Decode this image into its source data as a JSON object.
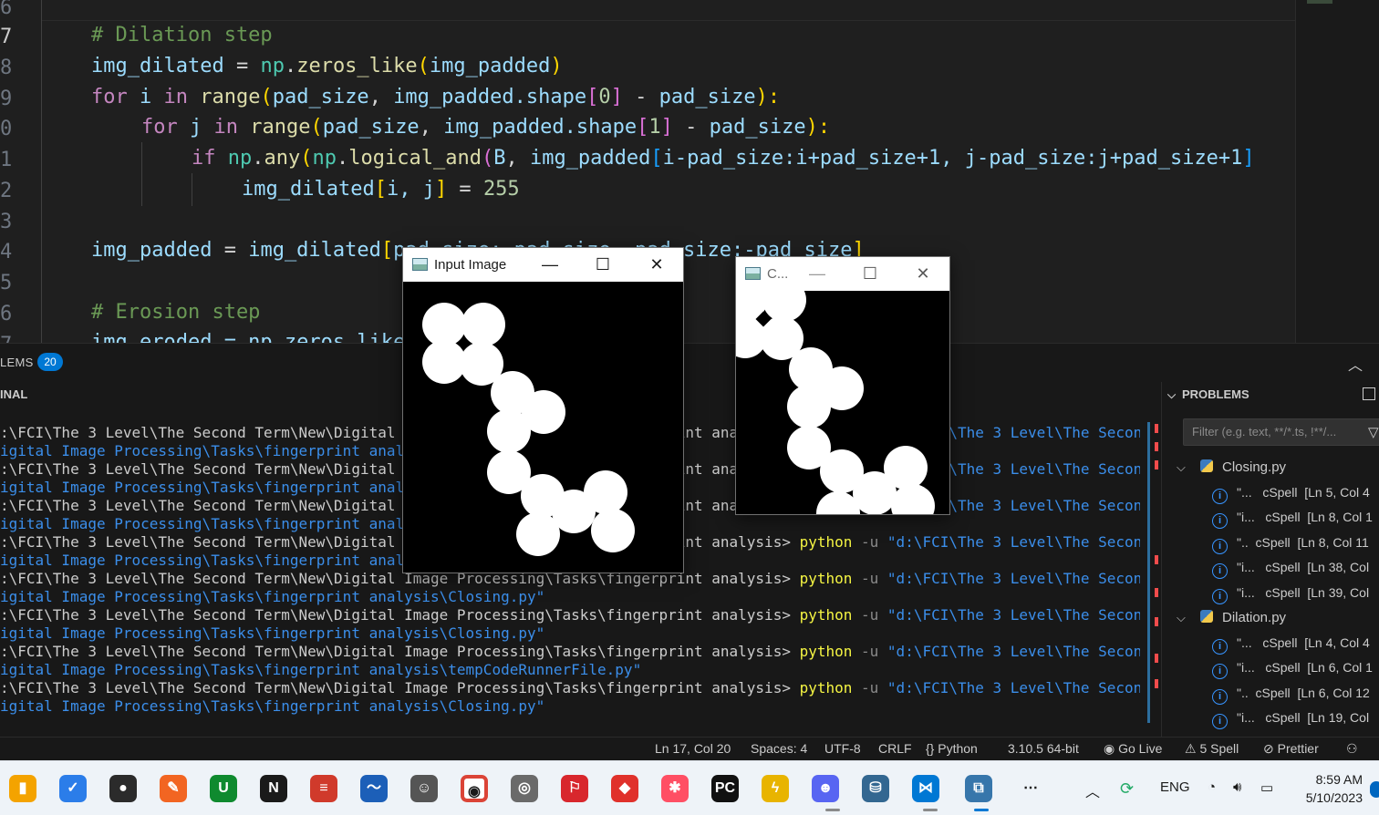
{
  "editor": {
    "line_numbers": [
      "6",
      "7",
      "8",
      "9",
      "0",
      "1",
      "2",
      "3",
      "4",
      "5",
      "6",
      "7"
    ],
    "code": {
      "comment_dilation": "# Dilation step",
      "l8": {
        "a": "img_dilated",
        "b": " = ",
        "c": "np",
        "d": ".",
        "e": "zeros_like",
        "f": "(",
        "g": "img_padded",
        "h": ")"
      },
      "l9": {
        "a": "for",
        "b": " ",
        "c": "i",
        "d": " in ",
        "e": "range",
        "f": "(",
        "g": "pad_size",
        "h": ", ",
        "i": "img_padded",
        "j": ".shape",
        "k": "[",
        "l": "0",
        "m": "]",
        "n": " - ",
        "o": "pad_size",
        "p": "):"
      },
      "l10": {
        "a": "for",
        "b": " ",
        "c": "j",
        "d": " in ",
        "e": "range",
        "f": "(",
        "g": "pad_size",
        "h": ", ",
        "i": "img_padded",
        "j": ".shape",
        "k": "[",
        "l": "1",
        "m": "]",
        "n": " - ",
        "o": "pad_size",
        "p": "):"
      },
      "l11": {
        "a": "if",
        "b": " ",
        "c": "np",
        "d": ".",
        "e": "any",
        "f": "(",
        "g": "np",
        "h": ".",
        "i": "logical_and",
        "j": "(",
        "k": "B",
        "l": ", ",
        "m": "img_padded",
        "n": "[",
        "o": "i-pad_size:i+pad_size+1, j-pad_size:j+pad_size+1",
        "p": "]"
      },
      "l12": {
        "a": "img_dilated",
        "b": "[",
        "c": "i, j",
        "d": "]",
        "e": " = ",
        "f": "255"
      },
      "l14": {
        "a": "img_padded",
        "b": " = ",
        "c": "img_dilated",
        "d": "[",
        "e": "pad_size:-pad_size, pad_size:-pad_size",
        "f": "]"
      },
      "comment_erosion": "# Erosion step",
      "l17": "img_eroded = np.zeros_like(img_padded)"
    }
  },
  "panel": {
    "problems_tab_label": "LEMS",
    "problems_count": "20",
    "terminal_title": "INAL",
    "terminal": {
      "prompt": ":\\FCI\\The 3 Level\\The Second Term\\New\\Digital Image Processing\\Tasks\\fingerprint analysis> ",
      "cmd": "python",
      "flag": " -u ",
      "arg_prefix": "\"d:\\FCI\\The 3 Level\\The Second Term\\N",
      "continuations": [
        "igital Image Processing\\Tasks\\fingerprint analysis\\Closing.py\"",
        "igital Image Processing\\Tasks\\fingerprint analysis\\Closing.py\"",
        "igital Image Processing\\Tasks\\fingerprint analysis\\Closing.py\"",
        "igital Image Processing\\Tasks\\fingerprint analysis\\Closing.py\"",
        "igital Image Processing\\Tasks\\fingerprint analysis\\Closing.py\"",
        "igital Image Processing\\Tasks\\fingerprint analysis\\Closing.py\"",
        "igital Image Processing\\Tasks\\fingerprint analysis\\tempCodeRunnerFile.py\"",
        "igital Image Processing\\Tasks\\fingerprint analysis\\Closing.py\""
      ]
    },
    "problems": {
      "title": "PROBLEMS",
      "filter_placeholder": "Filter (e.g. text, **/*.ts, !**/...",
      "files": [
        {
          "name": "Closing.py",
          "items": [
            {
              "text": "\"...",
              "src": "cSpell",
              "loc": "[Ln 5, Col 4"
            },
            {
              "text": "\"i...",
              "src": "cSpell",
              "loc": "[Ln 8, Col 1"
            },
            {
              "text": "\"..",
              "src": "cSpell",
              "loc": "[Ln 8, Col 11"
            },
            {
              "text": "\"i...",
              "src": "cSpell",
              "loc": "[Ln 38, Col"
            },
            {
              "text": "\"i...",
              "src": "cSpell",
              "loc": "[Ln 39, Col"
            }
          ]
        },
        {
          "name": "Dilation.py",
          "items": [
            {
              "text": "\"...",
              "src": "cSpell",
              "loc": "[Ln 4, Col 4"
            },
            {
              "text": "\"i...",
              "src": "cSpell",
              "loc": "[Ln 6, Col 1"
            },
            {
              "text": "\"..",
              "src": "cSpell",
              "loc": "[Ln 6, Col 12"
            },
            {
              "text": "\"i...",
              "src": "cSpell",
              "loc": "[Ln 19, Col"
            }
          ]
        }
      ]
    }
  },
  "statusbar": {
    "position": "Ln 17, Col 20",
    "spaces": "Spaces: 4",
    "encoding": "UTF-8",
    "eol": "CRLF",
    "language": "Python",
    "interpreter": "3.10.5 64-bit",
    "golive": "Go Live",
    "spell": "5 Spell",
    "prettier": "Prettier"
  },
  "windows": {
    "input": {
      "title": "Input Image"
    },
    "closing": {
      "title": "C..."
    }
  },
  "taskbar": {
    "apps": [
      "onenote-like-icon",
      "todo-icon",
      "obs-icon",
      "pen-icon",
      "upwork-icon",
      "notion-icon",
      "stack-icon",
      "chart-icon",
      "ollama-icon",
      "chrome-icon",
      "photo-icon",
      "bitdefender-icon",
      "git-icon",
      "dots-icon",
      "pycharm-icon",
      "power-icon",
      "discord-icon",
      "postgres-icon",
      "vscode-icon",
      "python-icon",
      "more-icon"
    ],
    "language": "ENG",
    "time": "8:59 AM",
    "date": "5/10/2023",
    "colors": {
      "accent": "#0078d4",
      "more": "#1a1a1a"
    }
  }
}
